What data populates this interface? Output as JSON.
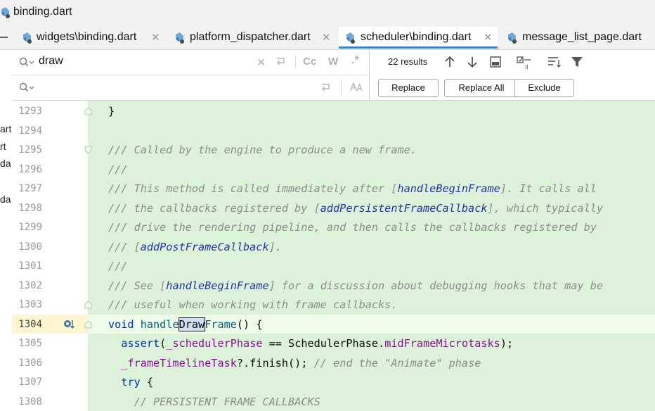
{
  "window": {
    "title": "binding.dart"
  },
  "tabs": [
    {
      "label": "widgets\\binding.dart",
      "active": false
    },
    {
      "label": "platform_dispatcher.dart",
      "active": false
    },
    {
      "label": "scheduler\\binding.dart",
      "active": true
    },
    {
      "label": "message_list_page.dart",
      "active": false
    }
  ],
  "find": {
    "query": "draw",
    "replace_value": "",
    "results": "22 results",
    "toggles": {
      "case": "Cc",
      "words": "W",
      "regex": ".*"
    },
    "buttons": {
      "replace": "Replace",
      "replace_all": "Replace All",
      "exclude": "Exclude"
    }
  },
  "left_strip": [
    "art",
    "rt",
    "da",
    "da"
  ],
  "editor": {
    "lines": [
      {
        "n": "1293",
        "parts": [
          [
            "p",
            "}"
          ]
        ]
      },
      {
        "n": "1294",
        "parts": []
      },
      {
        "n": "1295",
        "parts": [
          [
            "cm",
            "/// Called by the engine to produce a new frame."
          ]
        ]
      },
      {
        "n": "1296",
        "parts": [
          [
            "cm",
            "///"
          ]
        ]
      },
      {
        "n": "1297",
        "parts": [
          [
            "cm",
            "/// This method is called immediately after ["
          ],
          [
            "ref",
            "handleBeginFrame"
          ],
          [
            "cm",
            "]. It calls all"
          ]
        ]
      },
      {
        "n": "1298",
        "parts": [
          [
            "cm",
            "/// the callbacks registered by ["
          ],
          [
            "ref",
            "addPersistentFrameCallback"
          ],
          [
            "cm",
            "], which typically"
          ]
        ]
      },
      {
        "n": "1299",
        "parts": [
          [
            "cm",
            "/// drive the rendering pipeline, and then calls the callbacks registered by"
          ]
        ]
      },
      {
        "n": "1300",
        "parts": [
          [
            "cm",
            "/// ["
          ],
          [
            "ref",
            "addPostFrameCallback"
          ],
          [
            "cm",
            "]."
          ]
        ]
      },
      {
        "n": "1301",
        "parts": [
          [
            "cm",
            "///"
          ]
        ]
      },
      {
        "n": "1302",
        "parts": [
          [
            "cm",
            "/// See ["
          ],
          [
            "ref",
            "handleBeginFrame"
          ],
          [
            "cm",
            "] for a discussion about debugging hooks that may be"
          ]
        ]
      },
      {
        "n": "1303",
        "parts": [
          [
            "cm",
            "/// useful when working with frame callbacks."
          ]
        ]
      },
      {
        "n": "1304",
        "parts": [
          [
            "kw",
            "void"
          ],
          [
            "p",
            " "
          ],
          [
            "fn",
            "handle"
          ],
          [
            "hl",
            "Draw"
          ],
          [
            "fn",
            "Frame"
          ],
          [
            "p",
            "() {"
          ]
        ]
      },
      {
        "n": "1305",
        "parts": [
          [
            "p",
            "  "
          ],
          [
            "kw",
            "assert"
          ],
          [
            "p",
            "("
          ],
          [
            "fd",
            "_schedulerPhase"
          ],
          [
            "p",
            " == SchedulerPhase."
          ],
          [
            "en",
            "midFrameMicrotasks"
          ],
          [
            "p",
            ");"
          ]
        ]
      },
      {
        "n": "1306",
        "parts": [
          [
            "p",
            "  "
          ],
          [
            "fd",
            "_frameTimelineTask"
          ],
          [
            "p",
            "?.finish(); "
          ],
          [
            "cm",
            "// end the \"Animate\" phase"
          ]
        ]
      },
      {
        "n": "1307",
        "parts": [
          [
            "p",
            "  "
          ],
          [
            "kw",
            "try"
          ],
          [
            "p",
            " {"
          ]
        ]
      },
      {
        "n": "1308",
        "parts": [
          [
            "p",
            "    "
          ],
          [
            "cm",
            "// PERSISTENT FRAME CALLBACKS"
          ]
        ]
      }
    ],
    "current_line": "1304"
  }
}
